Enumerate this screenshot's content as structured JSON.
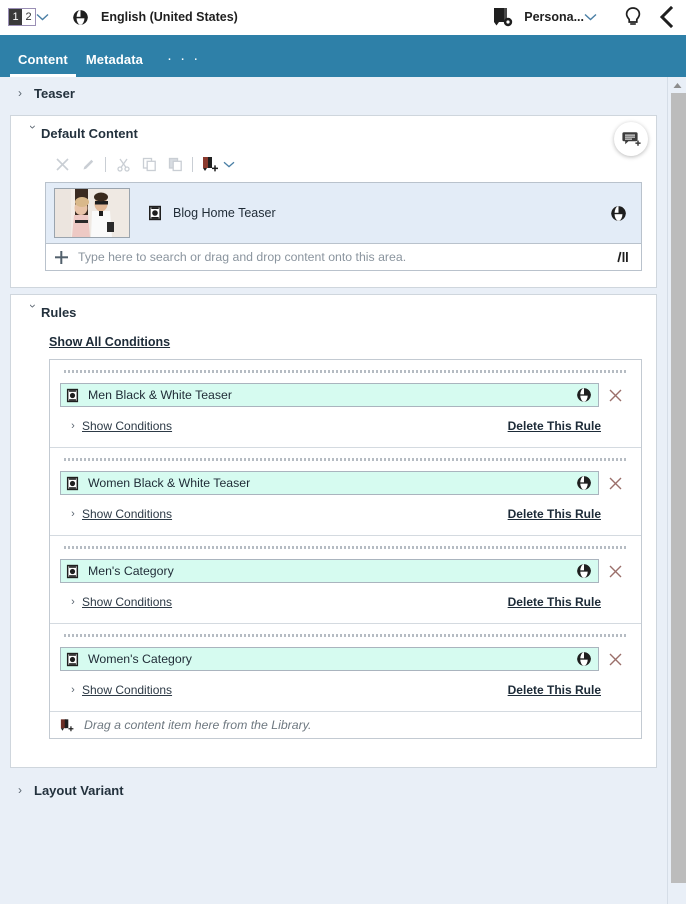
{
  "topbar": {
    "version_selector": {
      "name": "version-selector",
      "versions": [
        "1",
        "2"
      ],
      "selected": "1"
    },
    "language_icon": "globe-icon",
    "language": "English (United States)",
    "persona_icon": "content-settings-icon",
    "persona_label": "Persona...",
    "bulb_icon": "lightbulb-icon",
    "back_icon": "chevron-left-icon"
  },
  "tabs": [
    {
      "label": "Content",
      "active": true
    },
    {
      "label": "Metadata",
      "active": false
    }
  ],
  "tabs_more": "· · ·",
  "sections": {
    "teaser": {
      "title": "Teaser",
      "expanded": false,
      "caret": "chevron-right-icon"
    },
    "default_content": {
      "title": "Default Content",
      "expanded": true,
      "caret": "chevron-down-icon",
      "comment_icon": "add-comment-icon",
      "toolbar": [
        {
          "name": "remove-icon",
          "glyph": "×",
          "enabled": false
        },
        {
          "name": "edit-pencil-icon",
          "glyph": "✎",
          "enabled": false
        },
        {
          "name": "cut-icon",
          "glyph": "✂",
          "enabled": false
        },
        {
          "name": "copy-icon",
          "glyph": "⧉",
          "enabled": false
        },
        {
          "name": "paste-icon",
          "glyph": "❐",
          "enabled": false
        },
        {
          "name": "insert-content-icon",
          "glyph": "▣",
          "enabled": true
        }
      ],
      "toolbar_caret": "chevron-down-icon",
      "item": {
        "thumbnail": "couple-photo-thumbnail",
        "doc_icon": "content-item-icon",
        "title": "Blog Home Teaser",
        "globe_icon": "globe-icon"
      },
      "search": {
        "plus_icon": "plus-icon",
        "value": "",
        "placeholder": "Type here to search or drag and drop content onto this area.",
        "sort_icon": "sort-icon"
      }
    },
    "rules": {
      "title": "Rules",
      "expanded": true,
      "caret": "chevron-down-icon",
      "show_all_conditions": "Show All Conditions",
      "items": [
        {
          "doc_icon": "content-item-icon",
          "name": "Men Black & White Teaser",
          "globe_icon": "globe-icon",
          "remove_icon": "close-icon",
          "show_conditions": "Show Conditions",
          "conditions_caret": "chevron-right-icon",
          "delete_rule": "Delete This Rule"
        },
        {
          "doc_icon": "content-item-icon",
          "name": "Women Black & White Teaser",
          "globe_icon": "globe-icon",
          "remove_icon": "close-icon",
          "show_conditions": "Show Conditions",
          "conditions_caret": "chevron-right-icon",
          "delete_rule": "Delete This Rule"
        },
        {
          "doc_icon": "content-item-icon",
          "name": "Men's Category",
          "globe_icon": "globe-icon",
          "remove_icon": "close-icon",
          "show_conditions": "Show Conditions",
          "conditions_caret": "chevron-right-icon",
          "delete_rule": "Delete This Rule"
        },
        {
          "doc_icon": "content-item-icon",
          "name": "Women's Category",
          "globe_icon": "globe-icon",
          "remove_icon": "close-icon",
          "show_conditions": "Show Conditions",
          "conditions_caret": "chevron-right-icon",
          "delete_rule": "Delete This Rule"
        }
      ],
      "drop_zone": {
        "icon": "drag-content-icon",
        "text": "Drag a content item here from the Library."
      }
    },
    "layout_variant": {
      "title": "Layout Variant",
      "expanded": false,
      "caret": "chevron-right-icon"
    }
  },
  "scrollbar": {
    "up_arrow": "triangle-up-icon"
  },
  "colors": {
    "header_teal": "#2e80a8",
    "page_bg": "#e9eff7",
    "selected_item_bg": "#e3ecf7",
    "rule_item_bg": "#d6fbf0",
    "link_blue": "#4a7fa5"
  }
}
